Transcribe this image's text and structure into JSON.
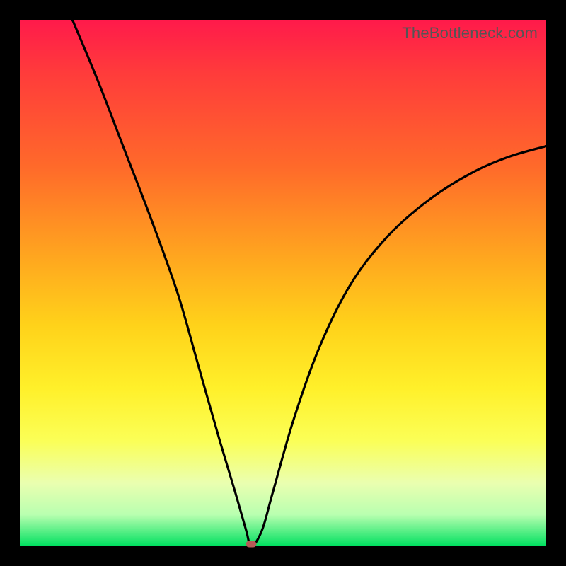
{
  "watermark": "TheBottleneck.com",
  "colors": {
    "frame": "#000000",
    "curve": "#000000",
    "marker": "#b65a57"
  },
  "chart_data": {
    "type": "line",
    "title": "",
    "xlabel": "",
    "ylabel": "",
    "xlim": [
      0,
      100
    ],
    "ylim": [
      0,
      100
    ],
    "grid": false,
    "legend": false,
    "optimum_x": 44,
    "series": [
      {
        "name": "bottleneck-curve",
        "x": [
          10,
          15,
          20,
          25,
          30,
          34,
          38,
          41,
          43,
          44,
          46,
          48,
          52,
          57,
          63,
          70,
          78,
          86,
          93,
          100
        ],
        "y": [
          100,
          88,
          75,
          62,
          48,
          34,
          20,
          10,
          3,
          0,
          3,
          10,
          24,
          38,
          50,
          59,
          66,
          71,
          74,
          76
        ]
      }
    ],
    "marker": {
      "x": 44,
      "y": 0
    }
  }
}
